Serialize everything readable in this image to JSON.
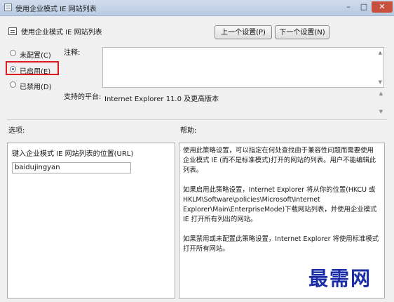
{
  "window": {
    "title": "使用企业模式 IE 网站列表",
    "controls": {
      "minimize": "–",
      "maximize": "□",
      "close": "✕"
    }
  },
  "header": {
    "policy_title": "使用企业模式 IE 网站列表",
    "prev_button": "上一个设置(P)",
    "next_button": "下一个设置(N)"
  },
  "state": {
    "options": [
      {
        "label": "未配置(C)",
        "checked": false
      },
      {
        "label": "已启用(E)",
        "checked": true
      },
      {
        "label": "已禁用(D)",
        "checked": false
      }
    ]
  },
  "note": {
    "label": "注释:",
    "value": ""
  },
  "platform": {
    "label": "支持的平台:",
    "value": "Internet Explorer 11.0 及更高版本"
  },
  "options_panel": {
    "label": "选项:",
    "field_label": "键入企业模式 IE 网站列表的位置(URL)",
    "field_value": "baidujingyan"
  },
  "help_panel": {
    "label": "帮助:",
    "paragraphs": [
      "使用此策略设置，可以指定在何处查找由于兼容性问题而需要使用企业模式 IE (而不是标准模式)打开的网站的列表。用户不能编辑此列表。",
      "如果启用此策略设置，Internet Explorer 将从你的位置(HKCU 或 HKLM\\Software\\policies\\Microsoft\\Internet Explorer\\Main\\EnterpriseMode)下载网站列表，并使用企业模式 IE 打开所有列出的网站。",
      "如果禁用或未配置此策略设置，Internet Explorer 将使用标准模式打开所有网站。"
    ]
  },
  "watermark": "最需网",
  "colors": {
    "highlight": "#e0191c",
    "watermark": "#1b2ea8"
  }
}
